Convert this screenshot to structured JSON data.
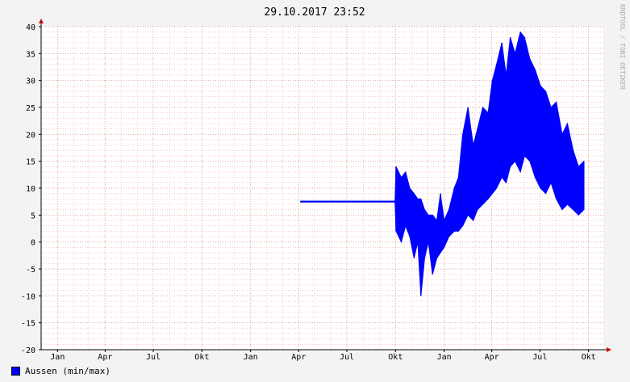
{
  "colors": {
    "series": "#0000ff",
    "grid_minor": "#ffc6c6",
    "grid_major": "#e9a1a1",
    "axis": "#000000",
    "arrow": "#cc0000",
    "watermark": "#aaaaaa"
  },
  "chart_data": {
    "type": "area",
    "title": "29.10.2017 23:52",
    "watermark": "RRDTOOL / TOBI OETIKER",
    "xlabel": "",
    "ylabel": "",
    "ylim": [
      -20,
      40
    ],
    "xlim": [
      "2014-12-01",
      "2017-10-29"
    ],
    "yticks": [
      "-20",
      "-15",
      "-10",
      "-5",
      "0",
      "5",
      "10",
      "15",
      "20",
      "25",
      "30",
      "35",
      "40"
    ],
    "xticks": [
      {
        "date": "2015-01-01",
        "label": "Jan"
      },
      {
        "date": "2015-04-01",
        "label": "Apr"
      },
      {
        "date": "2015-07-01",
        "label": "Jul"
      },
      {
        "date": "2015-10-01",
        "label": "Okt"
      },
      {
        "date": "2016-01-01",
        "label": "Jan"
      },
      {
        "date": "2016-04-01",
        "label": "Apr"
      },
      {
        "date": "2016-07-01",
        "label": "Jul"
      },
      {
        "date": "2016-10-01",
        "label": "Okt"
      },
      {
        "date": "2017-01-01",
        "label": "Jan"
      },
      {
        "date": "2017-04-01",
        "label": "Apr"
      },
      {
        "date": "2017-07-01",
        "label": "Jul"
      },
      {
        "date": "2017-10-01",
        "label": "Okt"
      }
    ],
    "legend_position": "bottom-left",
    "grid": true,
    "series": [
      {
        "name": "Aussen (min/max)",
        "points": [
          {
            "x": "2016-04-05",
            "min": 7.4,
            "max": 7.6
          },
          {
            "x": "2016-09-30",
            "min": 7.4,
            "max": 7.6
          },
          {
            "x": "2016-10-02",
            "min": 2,
            "max": 14
          },
          {
            "x": "2016-10-12",
            "min": 0,
            "max": 12
          },
          {
            "x": "2016-10-20",
            "min": 3,
            "max": 13
          },
          {
            "x": "2016-10-28",
            "min": 1,
            "max": 10
          },
          {
            "x": "2016-11-05",
            "min": -3,
            "max": 9
          },
          {
            "x": "2016-11-12",
            "min": 0,
            "max": 8
          },
          {
            "x": "2016-11-18",
            "min": -10,
            "max": 8
          },
          {
            "x": "2016-11-25",
            "min": -3,
            "max": 6
          },
          {
            "x": "2016-12-02",
            "min": 0,
            "max": 5
          },
          {
            "x": "2016-12-10",
            "min": -6,
            "max": 5
          },
          {
            "x": "2016-12-18",
            "min": -3,
            "max": 4
          },
          {
            "x": "2016-12-25",
            "min": -2,
            "max": 9
          },
          {
            "x": "2017-01-01",
            "min": -1,
            "max": 4
          },
          {
            "x": "2017-01-10",
            "min": 1,
            "max": 6
          },
          {
            "x": "2017-01-20",
            "min": 2,
            "max": 10
          },
          {
            "x": "2017-01-28",
            "min": 2,
            "max": 12
          },
          {
            "x": "2017-02-05",
            "min": 3,
            "max": 20
          },
          {
            "x": "2017-02-15",
            "min": 5,
            "max": 25
          },
          {
            "x": "2017-02-25",
            "min": 4,
            "max": 18
          },
          {
            "x": "2017-03-05",
            "min": 6,
            "max": 21
          },
          {
            "x": "2017-03-15",
            "min": 7,
            "max": 25
          },
          {
            "x": "2017-03-25",
            "min": 8,
            "max": 24
          },
          {
            "x": "2017-04-02",
            "min": 9,
            "max": 30
          },
          {
            "x": "2017-04-10",
            "min": 10,
            "max": 33
          },
          {
            "x": "2017-04-20",
            "min": 12,
            "max": 37
          },
          {
            "x": "2017-04-28",
            "min": 11,
            "max": 31
          },
          {
            "x": "2017-05-06",
            "min": 14,
            "max": 38
          },
          {
            "x": "2017-05-15",
            "min": 15,
            "max": 35
          },
          {
            "x": "2017-05-25",
            "min": 13,
            "max": 39
          },
          {
            "x": "2017-06-02",
            "min": 16,
            "max": 38
          },
          {
            "x": "2017-06-12",
            "min": 15,
            "max": 34
          },
          {
            "x": "2017-06-22",
            "min": 12,
            "max": 32
          },
          {
            "x": "2017-07-02",
            "min": 10,
            "max": 29
          },
          {
            "x": "2017-07-12",
            "min": 9,
            "max": 28
          },
          {
            "x": "2017-07-22",
            "min": 11,
            "max": 25
          },
          {
            "x": "2017-08-01",
            "min": 8,
            "max": 26
          },
          {
            "x": "2017-08-12",
            "min": 6,
            "max": 20
          },
          {
            "x": "2017-08-22",
            "min": 7,
            "max": 22
          },
          {
            "x": "2017-09-02",
            "min": 6,
            "max": 17
          },
          {
            "x": "2017-09-12",
            "min": 5,
            "max": 14
          },
          {
            "x": "2017-09-22",
            "min": 6,
            "max": 15
          }
        ]
      }
    ],
    "partial_points_note": ""
  }
}
